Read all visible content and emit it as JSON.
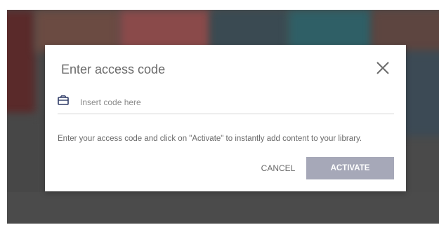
{
  "dialog": {
    "title": "Enter access code",
    "close_icon": "close-icon",
    "input": {
      "icon": "ticket-icon",
      "value": "",
      "placeholder": "Insert code here"
    },
    "helper_text": "Enter your access code and click on \"Activate\" to instantly add content to your library.",
    "cancel_label": "CANCEL",
    "activate_label": "ACTIVATE"
  },
  "colors": {
    "overlay": "#4a4a4a",
    "activate_button_bg": "#a6a8b8",
    "title_text": "#6b6b6b",
    "icon": "#2e3a66"
  }
}
